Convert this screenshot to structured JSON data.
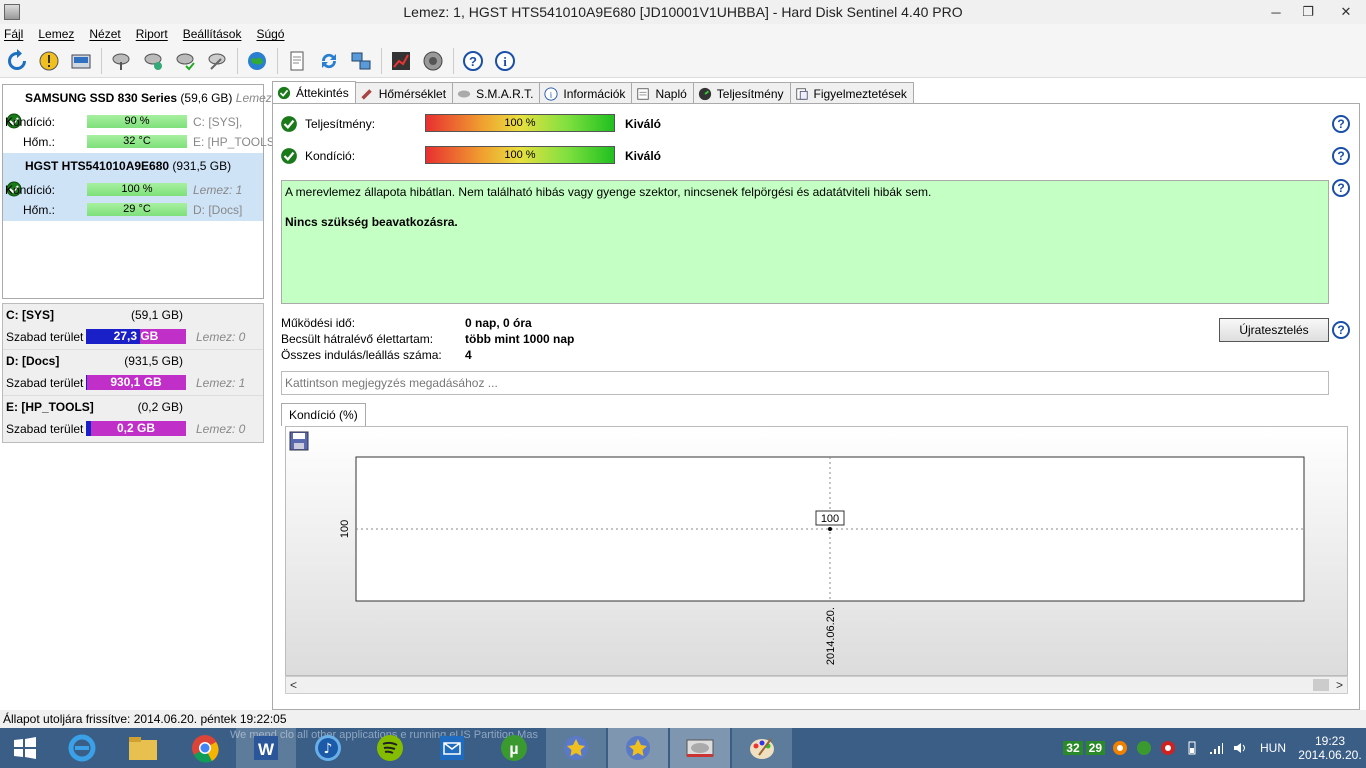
{
  "window": {
    "title": "Lemez: 1, HGST HTS541010A9E680 [JD10001V1UHBBA]  -  Hard Disk Sentinel 4.40 PRO",
    "min": "─",
    "max": "❐",
    "close": "✕"
  },
  "menu": [
    "Fájl",
    "Lemez",
    "Nézet",
    "Riport",
    "Beállítások",
    "Súgó"
  ],
  "toolbar_icons": [
    "refresh-icon",
    "alert-icon",
    "disk-info-icon",
    "disk-scan-icon",
    "disk-test-icon",
    "disk-ok-icon",
    "disk-settings-icon",
    "web-icon",
    "report-icon",
    "sync-icon",
    "network-icon",
    "chart-icon",
    "sound-icon",
    "help-icon",
    "info-icon"
  ],
  "disks": [
    {
      "name": "SAMSUNG SSD 830 Series",
      "size": "(59,6 GB)",
      "dev": "Lemez:",
      "cond_label": "Kondíció:",
      "cond": "90 %",
      "temp_label": "Hőm.:",
      "temp": "32 °C",
      "vol1": "C: [SYS],",
      "vol2": "E: [HP_TOOLS"
    },
    {
      "name": "HGST HTS541010A9E680",
      "size": "(931,5 GB)",
      "cond_label": "Kondíció:",
      "cond": "100 %",
      "temp_label": "Hőm.:",
      "temp": "29 °C",
      "vol1": "Lemez: 1",
      "vol2": "D: [Docs]"
    }
  ],
  "partitions": [
    {
      "name": "C: [SYS]",
      "size": "(59,1 GB)",
      "free_label": "Szabad terület",
      "free": "27,3 GB",
      "disk": "Lemez: 0",
      "used_pct": 54
    },
    {
      "name": "D: [Docs]",
      "size": "(931,5 GB)",
      "free_label": "Szabad terület",
      "free": "930,1 GB",
      "disk": "Lemez: 1",
      "used_pct": 1
    },
    {
      "name": "E: [HP_TOOLS]",
      "size": "(0,2 GB)",
      "free_label": "Szabad terület",
      "free": "0,2 GB",
      "disk": "Lemez: 0",
      "used_pct": 5
    }
  ],
  "tabs": [
    "Áttekintés",
    "Hőmérséklet",
    "S.M.A.R.T.",
    "Információk",
    "Napló",
    "Teljesítmény",
    "Figyelmeztetések"
  ],
  "overview": {
    "perf_label": "Teljesítmény:",
    "perf_value": "100 %",
    "perf_rating": "Kiváló",
    "cond_label": "Kondíció:",
    "cond_value": "100 %",
    "cond_rating": "Kiváló",
    "status_text": "A merevlemez állapota hibátlan. Nem található hibás vagy gyenge szektor, nincsenek felpörgési és adatátviteli hibák sem.",
    "status_action": "Nincs szükség beavatkozásra.",
    "uptime_label": "Működési idő:",
    "uptime": "0 nap, 0 óra",
    "life_label": "Becsült hátralévő élettartam:",
    "life": "több mint 1000 nap",
    "starts_label": "Összes indulás/leállás száma:",
    "starts": "4",
    "retest": "Újratesztelés",
    "note_placeholder": "Kattintson megjegyzés megadásához ..."
  },
  "chart_tab": "Kondíció  (%)",
  "chart_data": {
    "type": "line",
    "x": [
      "2014.06.20."
    ],
    "series": [
      {
        "values": [
          100
        ]
      }
    ],
    "ytick": "100",
    "xtick": "2014.06.20.",
    "point_label": "100"
  },
  "status": "Állapot utoljára frissítve: 2014.06.20. péntek 19:22:05",
  "taskbar": {
    "ghost_text": "We     mend clo   all other applications    e running   eUS Partition Mas",
    "tray_temp1": "32",
    "tray_temp2": "29",
    "lang": "HUN",
    "time": "19:23",
    "date": "2014.06.20."
  }
}
